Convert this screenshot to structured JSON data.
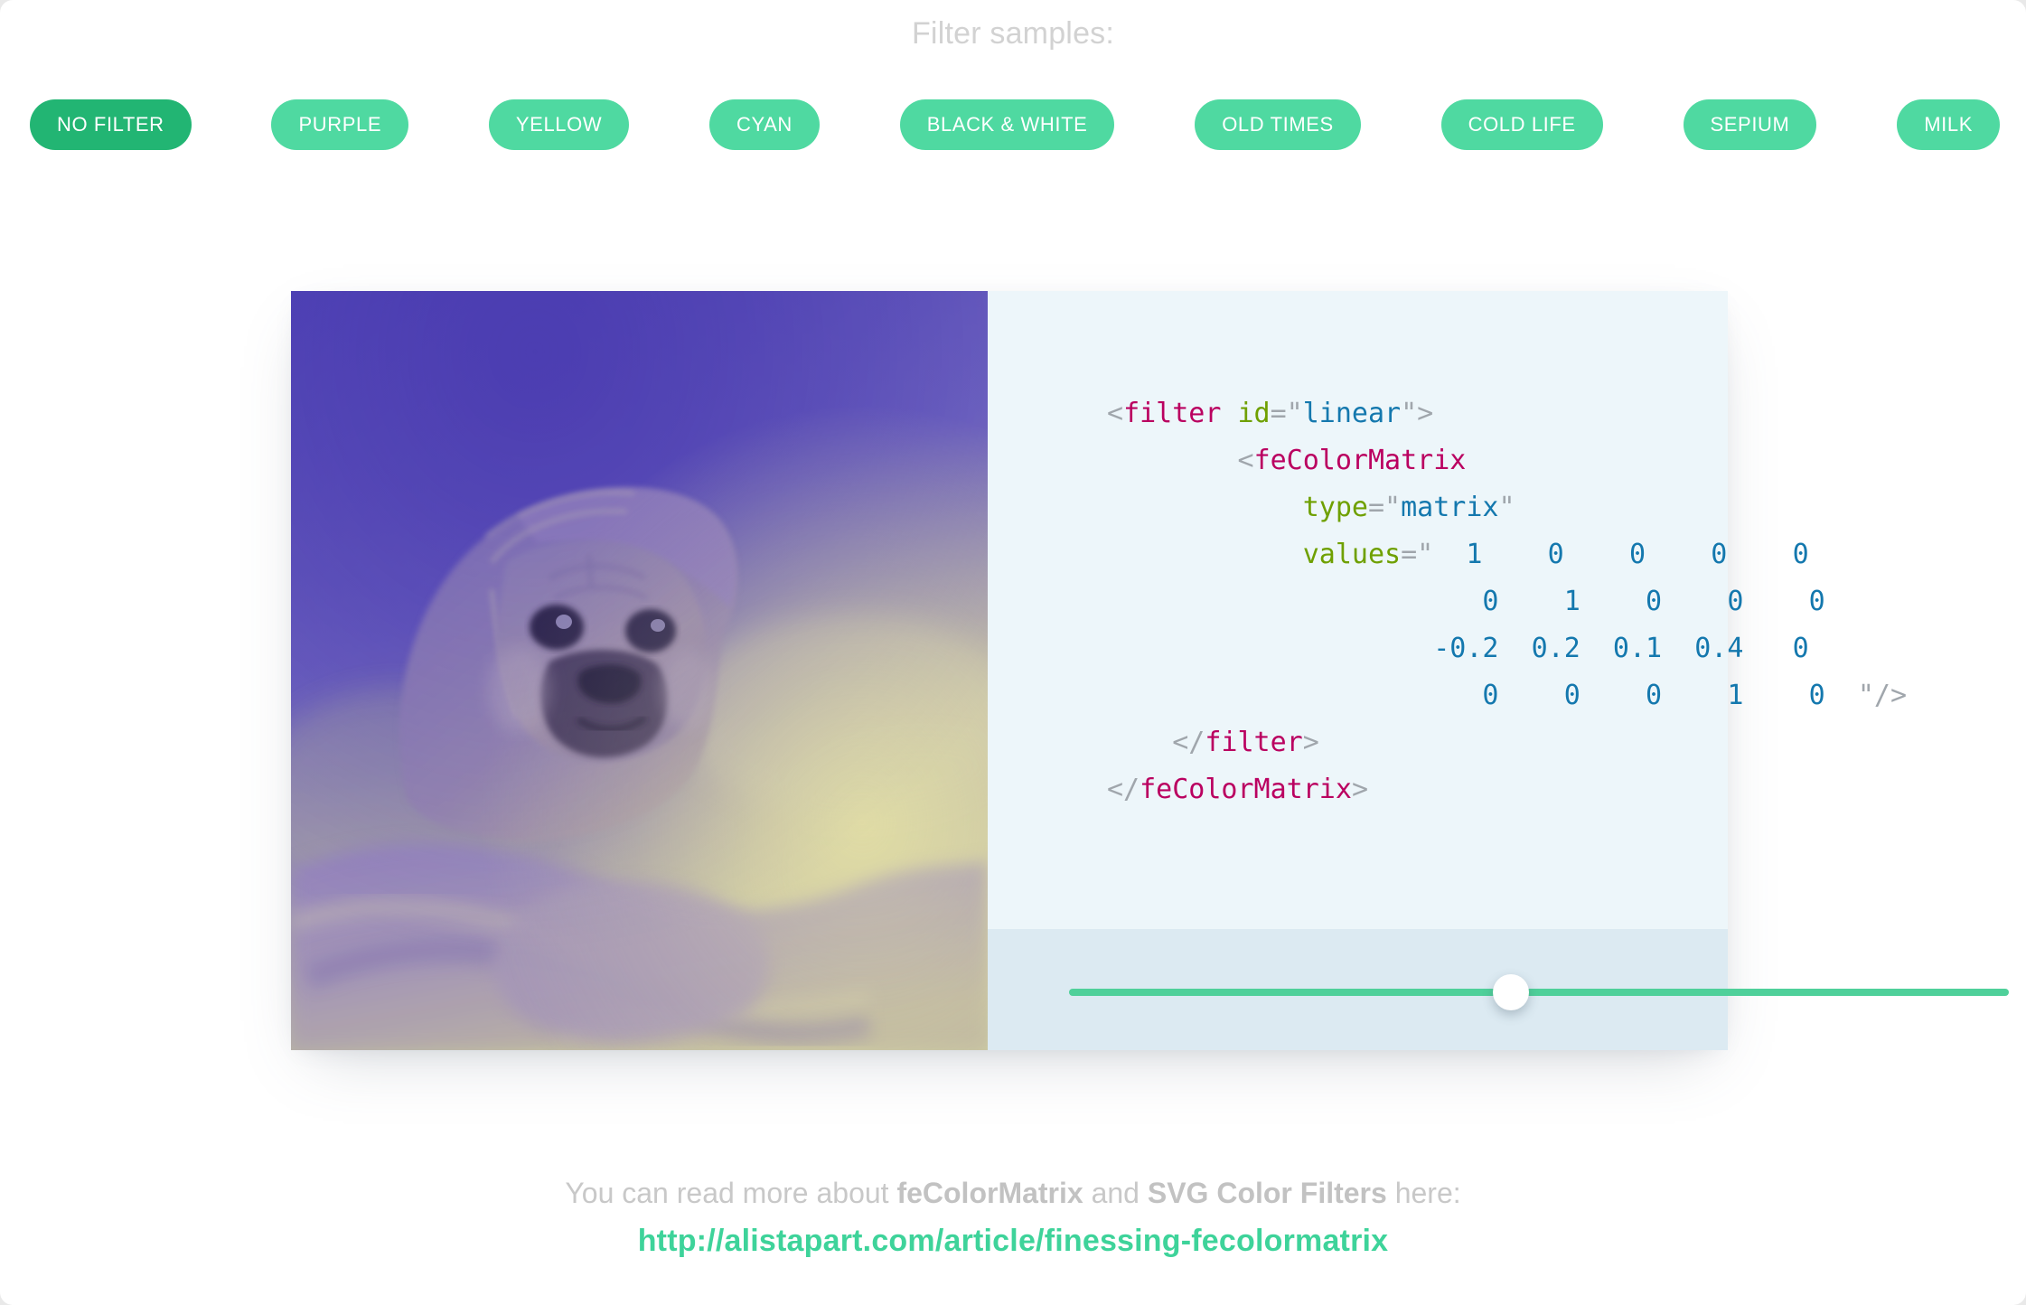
{
  "header": {
    "title": "Filter samples:"
  },
  "filters": {
    "active_index": 0,
    "active_color": "#22b573",
    "inactive_color": "#4fd9a1",
    "buttons": [
      {
        "label": "NO FILTER"
      },
      {
        "label": "PURPLE"
      },
      {
        "label": "YELLOW"
      },
      {
        "label": "CYAN"
      },
      {
        "label": "BLACK & WHITE"
      },
      {
        "label": "OLD TIMES"
      },
      {
        "label": "COLD LIFE"
      },
      {
        "label": "SEPIUM"
      },
      {
        "label": "MILK"
      }
    ]
  },
  "preview": {
    "alt": "pug dog wrapped in a blanket, purple and yellow duotone filter",
    "filter_name": "PURPLE"
  },
  "code": {
    "panel_background": "#edf6fa",
    "colors": {
      "punctuation": "#a0a6ac",
      "tag": "#ba0060",
      "attribute": "#6fa000",
      "string": "#1478ae",
      "number": "#1478ae"
    },
    "lines": [
      {
        "indent": 0,
        "parts": [
          {
            "t": "punc",
            "v": "<"
          },
          {
            "t": "tag",
            "v": "filter"
          },
          {
            "t": "punc",
            "v": " "
          },
          {
            "t": "attr",
            "v": "id"
          },
          {
            "t": "punc",
            "v": "=\""
          },
          {
            "t": "str",
            "v": "linear"
          },
          {
            "t": "punc",
            "v": "\">"
          }
        ]
      },
      {
        "indent": 2,
        "parts": [
          {
            "t": "punc",
            "v": "<"
          },
          {
            "t": "tag",
            "v": "feColorMatrix"
          }
        ]
      },
      {
        "indent": 3,
        "parts": [
          {
            "t": "attr",
            "v": "type"
          },
          {
            "t": "punc",
            "v": "=\""
          },
          {
            "t": "str",
            "v": "matrix"
          },
          {
            "t": "punc",
            "v": "\""
          }
        ]
      },
      {
        "indent": 3,
        "parts": [
          {
            "t": "attr",
            "v": "values"
          },
          {
            "t": "punc",
            "v": "=\""
          },
          {
            "t": "num",
            "v": "  1    0    0    0    0"
          }
        ]
      },
      {
        "indent": 3,
        "parts": [
          {
            "t": "num",
            "v": "           0    1    0    0    0"
          }
        ]
      },
      {
        "indent": 3,
        "parts": [
          {
            "t": "num",
            "v": "        -0.2  0.2  0.1  0.4   0"
          }
        ]
      },
      {
        "indent": 3,
        "parts": [
          {
            "t": "num",
            "v": "           0    0    0    1    0"
          },
          {
            "t": "punc",
            "v": "  \"/>"
          }
        ]
      },
      {
        "indent": 1,
        "parts": [
          {
            "t": "punc",
            "v": "</"
          },
          {
            "t": "tag",
            "v": "filter"
          },
          {
            "t": "punc",
            "v": ">"
          }
        ]
      },
      {
        "indent": 0,
        "parts": [
          {
            "t": "punc",
            "v": "</"
          },
          {
            "t": "tag",
            "v": "feColorMatrix"
          },
          {
            "t": "punc",
            "v": ">"
          }
        ]
      }
    ],
    "matrix_values": [
      [
        1,
        0,
        0,
        0,
        0
      ],
      [
        0,
        1,
        0,
        0,
        0
      ],
      [
        -0.2,
        0.2,
        0.1,
        0.4,
        0
      ],
      [
        0,
        0,
        0,
        1,
        0
      ]
    ],
    "filter_id": "linear",
    "type": "matrix"
  },
  "slider": {
    "value_percent": 47,
    "track_color": "#4fd09a",
    "thumb_color": "#ffffff",
    "panel_background": "#dceaf2"
  },
  "footer": {
    "prefix": "You can read more about ",
    "bold1": "feColorMatrix",
    "middle": " and ",
    "bold2": "SVG Color Filters",
    "suffix": " here:",
    "link_text": "http://alistapart.com/article/finessing-fecolormatrix",
    "link_color": "#3ed39a"
  }
}
